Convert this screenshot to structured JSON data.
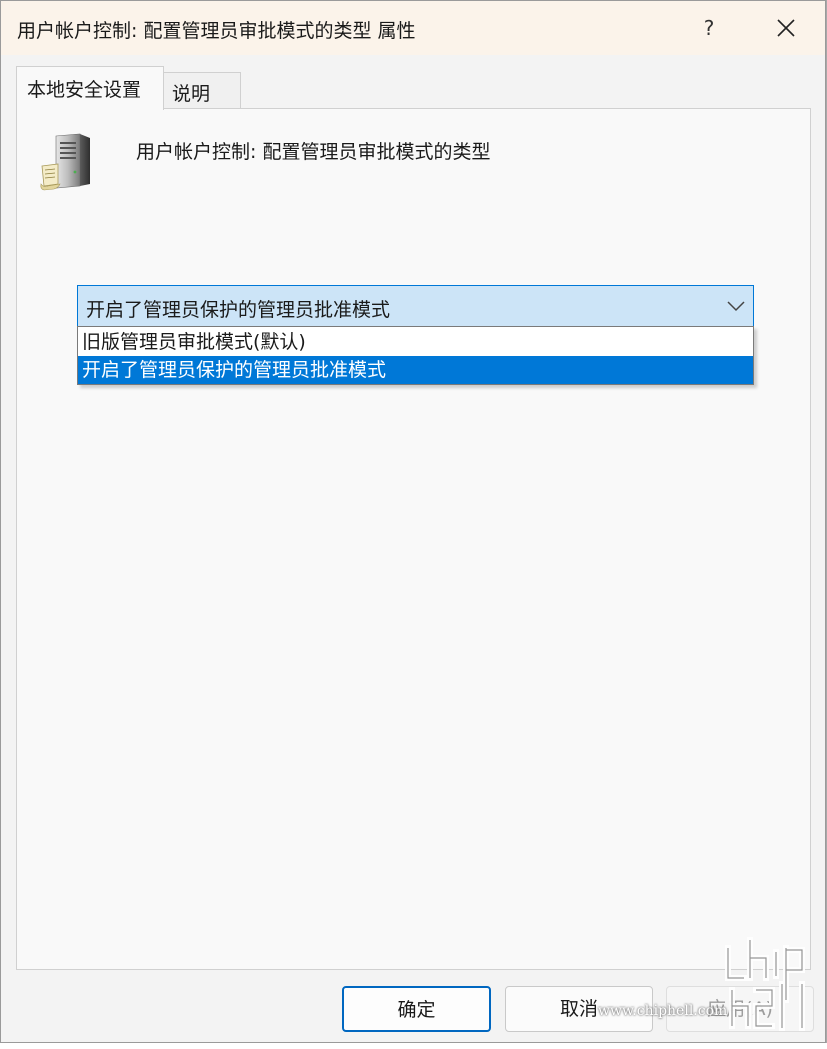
{
  "window": {
    "title": "用户帐户控制: 配置管理员审批模式的类型 属性",
    "help_label": "?",
    "close_icon": "close-icon"
  },
  "tabs": [
    {
      "label": "本地安全设置",
      "active": true
    },
    {
      "label": "说明",
      "active": false
    }
  ],
  "policy": {
    "icon": "server-policy-icon",
    "title": "用户帐户控制: 配置管理员审批模式的类型"
  },
  "combo": {
    "selected": "开启了管理员保护的管理员批准模式",
    "arrow_icon": "chevron-down-icon",
    "options": [
      "旧版管理员审批模式(默认)",
      "开启了管理员保护的管理员批准模式"
    ],
    "highlighted_index": 1
  },
  "buttons": {
    "ok": "确定",
    "cancel": "取消",
    "apply": "应用(A)"
  },
  "watermark": {
    "text": "www.chiphell.com",
    "logo": "chiphell-logo"
  },
  "colors": {
    "accent": "#0078d7",
    "combo_bg": "#cce4f7",
    "titlebar_bg": "#fbf3ea"
  }
}
